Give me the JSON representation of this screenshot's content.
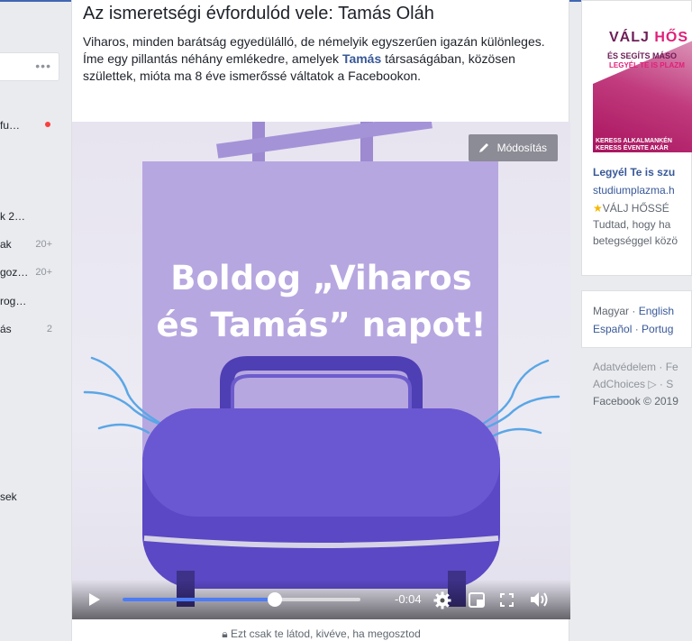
{
  "left_sidebar": {
    "search_more": "•••",
    "items": [
      {
        "label": "fu…",
        "count": "",
        "dot": true
      },
      {
        "label": "k 2…",
        "count": ""
      },
      {
        "label": "ak",
        "count": "20+"
      },
      {
        "label": "goz…",
        "count": "20+"
      },
      {
        "label": "rog…",
        "count": ""
      },
      {
        "label": "ás",
        "count": "2"
      },
      {
        "label": "sek",
        "count": ""
      }
    ]
  },
  "post": {
    "title": "Az ismeretségi évfordulód vele: Tamás Oláh",
    "desc_part1": "Viharos, minden barátság egyedülálló, de némelyik egyszerűen igazán különleges. Íme egy pillantás néhány emlékedre, amelyek ",
    "desc_highlight": "Tamás",
    "desc_part2": " társaságában, közösen születtek, mióta ma 8 éve ismerőssé váltatok a Facebookon.",
    "video": {
      "caption_line1": "Boldog „Viharos",
      "caption_line2": "és Tamás” napot!",
      "edit_label": "Módosítás",
      "time": "-0:04",
      "progress": 0.64
    },
    "privacy_text": "Ezt csak te látod, kivéve, ha megosztod"
  },
  "ad": {
    "image_line1_a": "VÁLJ ",
    "image_line1_b": "HŐS",
    "image_line2": "ÉS SEGÍTS MÁSO",
    "image_line3": "LEGYÉL TE IS PLAZM",
    "image_line4": "KERESS ALKALMANKÉN",
    "image_line5": "KERESS ÉVENTE AKÁR",
    "title": "Legyél Te is szu",
    "url": "studiumplazma.h",
    "text_line1": "VÁLJ HŐSSÉ",
    "text_line2": "Tudtad, hogy ha",
    "text_line3": "betegséggel közö"
  },
  "languages": {
    "current": "Magyar",
    "sep": " · ",
    "link1": "English",
    "link2": "Español",
    "link3": "Portug"
  },
  "footer": {
    "line1": "Adatvédelem · Fe",
    "line2": "AdChoices ▷ · S",
    "line3": "Facebook © 2019"
  }
}
